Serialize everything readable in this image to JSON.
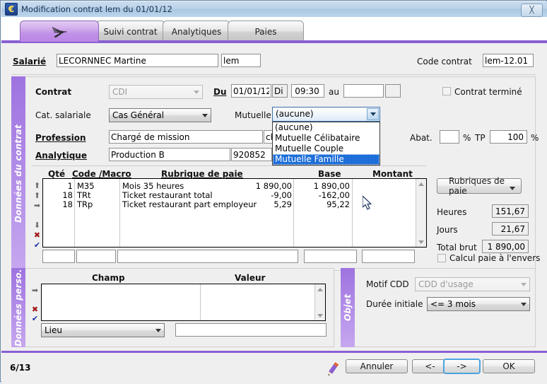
{
  "window": {
    "title": "Modification contrat lem du 01/01/12",
    "icon": "euro-icon",
    "close_label": "╳"
  },
  "tabs": [
    {
      "label": "",
      "icon": "dragonfly-icon",
      "active": true
    },
    {
      "label": "Suivi contrat",
      "active": false
    },
    {
      "label": "Analytiques",
      "active": false
    },
    {
      "label": "Paies",
      "active": false
    }
  ],
  "header": {
    "salarie_label": "Salarié",
    "salarie_value": "LECORNNEC Martine",
    "salarie_code": "lem",
    "code_contrat_label": "Code contrat",
    "code_contrat_value": "lem-12.01"
  },
  "sections": {
    "donnees_contrat": "Données du contrat",
    "donnees_perso": "Données perso.",
    "objet": "Objet"
  },
  "contrat": {
    "contrat_label": "Contrat",
    "contrat_value": "CDI",
    "du_label": "Du",
    "du_value": "01/01/12",
    "du_day": "Di",
    "heure_value": "09:30",
    "au_label": "au",
    "au_value": "",
    "au_day": "",
    "contrat_termine_label": "Contrat terminé",
    "contrat_termine_checked": false,
    "cat_salariale_label": "Cat. salariale",
    "cat_salariale_value": "Cas Général",
    "mutuelle_label": "Mutuelle",
    "mutuelle_value": "(aucune)",
    "mutuelle_options": [
      "(aucune)",
      "Mutuelle Célibataire",
      "Mutuelle Couple",
      "Mutuelle Famille"
    ],
    "mutuelle_selected_index": 3,
    "profession_label": "Profession",
    "profession_value": "Chargé de mission",
    "profession_code": "ch",
    "abat_label": "Abat.",
    "abat_value": "",
    "abat_unit": "%",
    "tp_label": "TP",
    "tp_value": "100",
    "tp_unit": "%",
    "analytique_label": "Analytique",
    "analytique_value": "Production B",
    "analytique_code": "920852"
  },
  "rubriques": {
    "headers": [
      "Qté",
      "Code /Macro",
      "Rubrique de paie",
      "Base",
      "Montant"
    ],
    "rows": [
      {
        "qte": "1",
        "code": "M35",
        "libelle": "Mois 35 heures",
        "base": "1 890,00",
        "montant": "1 890,00"
      },
      {
        "qte": "18",
        "code": "TRt",
        "libelle": "Ticket restaurant total",
        "base": "-9,00",
        "montant": "-162,00"
      },
      {
        "qte": "18",
        "code": "TRp",
        "libelle": "Ticket restaurant part employeur",
        "base": "5,29",
        "montant": "95,22"
      }
    ],
    "new_row": {
      "qte": "",
      "code": "",
      "libelle": "",
      "base": "",
      "montant": ""
    },
    "tools": [
      "move-top",
      "move-up",
      "move-right",
      "move-down",
      "delete",
      "validate"
    ]
  },
  "totals": {
    "rubriques_button": "Rubriques de paie",
    "heures_label": "Heures",
    "heures_value": "151,67",
    "jours_label": "Jours",
    "jours_value": "21,67",
    "total_brut_label": "Total brut",
    "total_brut_value": "1 890,00",
    "calcul_envers_label": "Calcul paie à l'envers",
    "calcul_envers_checked": false
  },
  "perso": {
    "headers": [
      "Champ",
      "Valeur"
    ],
    "rows": [],
    "field_select_value": "Lieu",
    "value_input": ""
  },
  "objet": {
    "motif_cdd_label": "Motif CDD",
    "motif_cdd_value": "CDD d'usage",
    "duree_initiale_label": "Durée initiale",
    "duree_initiale_value": "<= 3 mois"
  },
  "statusbar": {
    "page_counter": "6/13",
    "pencil_icon": "pencil-icon",
    "cancel_label": "Annuler",
    "prev_label": "<-",
    "next_label": "->",
    "ok_label": "OK"
  }
}
